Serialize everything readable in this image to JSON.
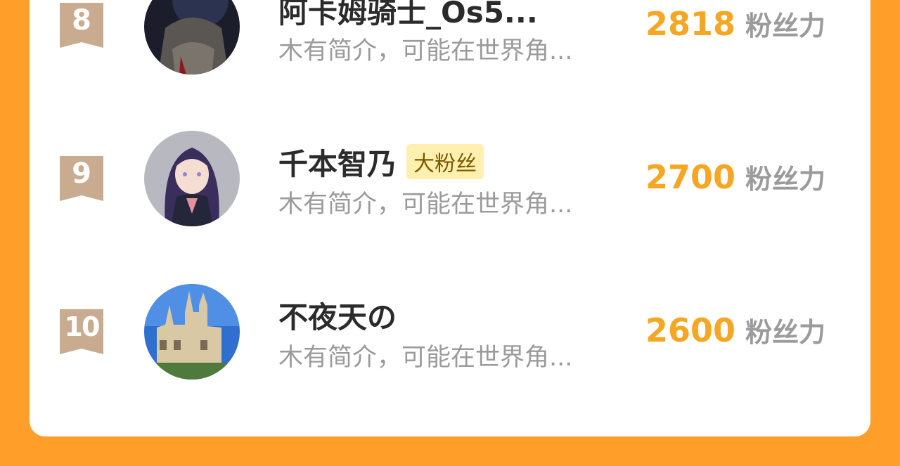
{
  "colors": {
    "background": "#ff9f2a",
    "card": "#ffffff",
    "score": "#f5a623",
    "badge": "#c9ab8f",
    "fan_badge_bg": "#fff0b0"
  },
  "ranking": [
    {
      "rank": "8",
      "name": "阿卡姆骑士_Os5...",
      "intro": "木有简介，可能在世界角...",
      "badge": "",
      "score": "2818",
      "score_unit": "粉丝力",
      "avatar": "armored-knight-avatar"
    },
    {
      "rank": "9",
      "name": "千本智乃",
      "intro": "木有简介，可能在世界角...",
      "badge": "大粉丝",
      "score": "2700",
      "score_unit": "粉丝力",
      "avatar": "anime-girl-avatar"
    },
    {
      "rank": "10",
      "name": "不夜天の",
      "intro": "木有简介，可能在世界角...",
      "badge": "",
      "score": "2600",
      "score_unit": "粉丝力",
      "avatar": "church-building-avatar"
    }
  ]
}
